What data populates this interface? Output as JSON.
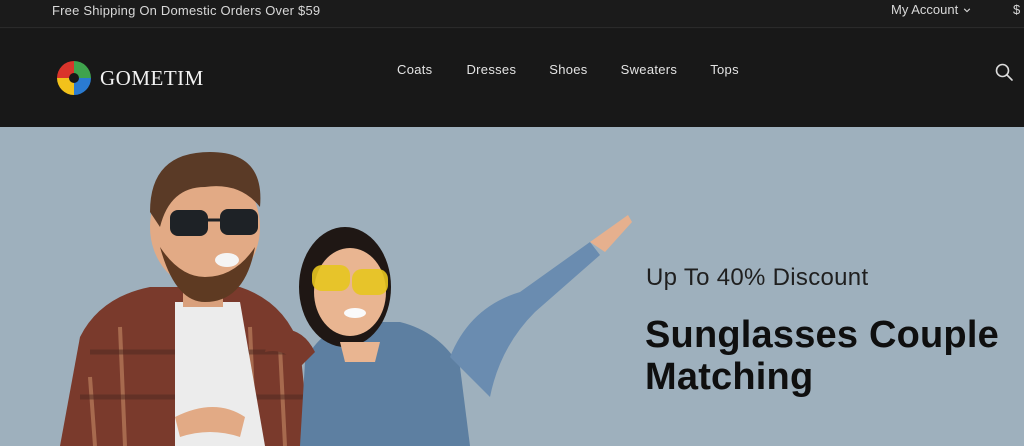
{
  "topbar": {
    "shipping_text": "Free Shipping On Domestic Orders Over $59",
    "account_label": "My Account",
    "currency_label": "$"
  },
  "header": {
    "logo_text": "GOMETIM",
    "nav": [
      "Coats",
      "Dresses",
      "Shoes",
      "Sweaters",
      "Tops"
    ],
    "icons": [
      "logo-icon",
      "search-icon",
      "chevron-down-icon"
    ]
  },
  "hero": {
    "promo_text": "Up To 40% Discount",
    "headline_line1": "Sunglasses Couple",
    "headline_line2": "Matching",
    "background_color": "#9eb0bd"
  },
  "colors": {
    "header_bg": "#181818",
    "topbar_bg": "#1b1b1b",
    "text_light": "#e3e3e3",
    "hero_text": "#0f0f0f"
  }
}
